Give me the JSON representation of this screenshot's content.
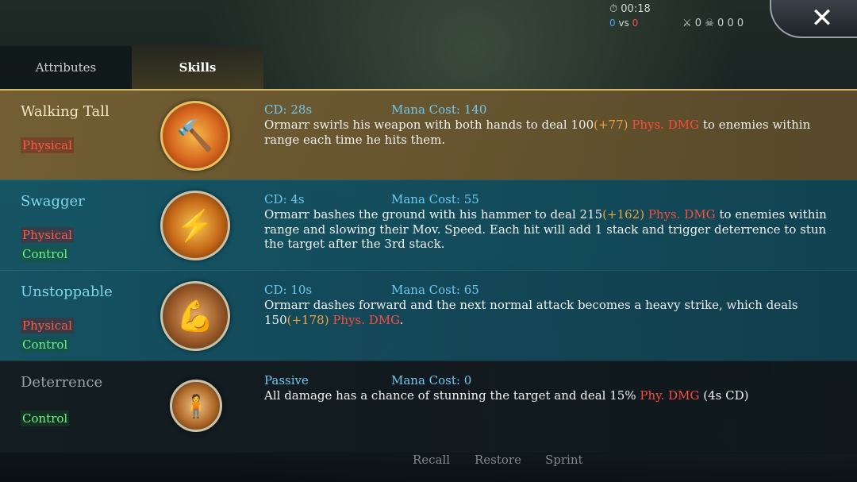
{
  "hud": {
    "timer": "00:18",
    "score_blue": "0",
    "vs": "vs",
    "score_red": "0",
    "kills": "0",
    "deaths": "0",
    "gold": "0",
    "other": "0"
  },
  "close": {
    "glyph": "✕"
  },
  "tabs": [
    {
      "label": "Attributes"
    },
    {
      "label": "Skills"
    }
  ],
  "skills": [
    {
      "name": "Walking Tall",
      "tags": [
        "Physical"
      ],
      "icon": "hammer-fire-icon",
      "cd": "CD: 28s",
      "mana": "Mana Cost: 140",
      "desc_a": "Ormarr swirls his weapon with both hands to deal 100",
      "ratio": "(+77)",
      "dmg": " Phys. DMG",
      "desc_b": " to enemies within range each time he hits them."
    },
    {
      "name": "Swagger",
      "tags": [
        "Physical",
        "Control"
      ],
      "icon": "hammer-lightning-icon",
      "cd": "CD: 4s",
      "mana": "Mana Cost: 55",
      "desc_a": "Ormarr bashes the ground with his hammer to deal 215",
      "ratio": "(+162)",
      "dmg": " Phys. DMG",
      "desc_b": " to enemies within range and slowing their Mov. Speed. Each hit will add 1 stack and trigger deterrence to stun the target after the 3rd stack."
    },
    {
      "name": "Unstoppable",
      "tags": [
        "Physical",
        "Control"
      ],
      "icon": "dash-icon",
      "cd": "CD: 10s",
      "mana": "Mana Cost: 65",
      "desc_a": "Ormarr dashes forward and the next normal attack becomes a heavy strike, which deals 150",
      "ratio": "(+178)",
      "dmg": " Phys. DMG",
      "desc_b": "."
    },
    {
      "name": "Deterrence",
      "tags": [
        "Control"
      ],
      "icon": "stun-icon",
      "cd": "Passive",
      "mana": "Mana Cost: 0",
      "desc_a": "All damage has a chance of stunning the target and deal 15% ",
      "ratio": "",
      "dmg": "Phy. DMG",
      "desc_b": " (4s CD)"
    }
  ],
  "bottom": {
    "recall": "Recall",
    "restore": "Restore",
    "sprint": "Sprint"
  }
}
